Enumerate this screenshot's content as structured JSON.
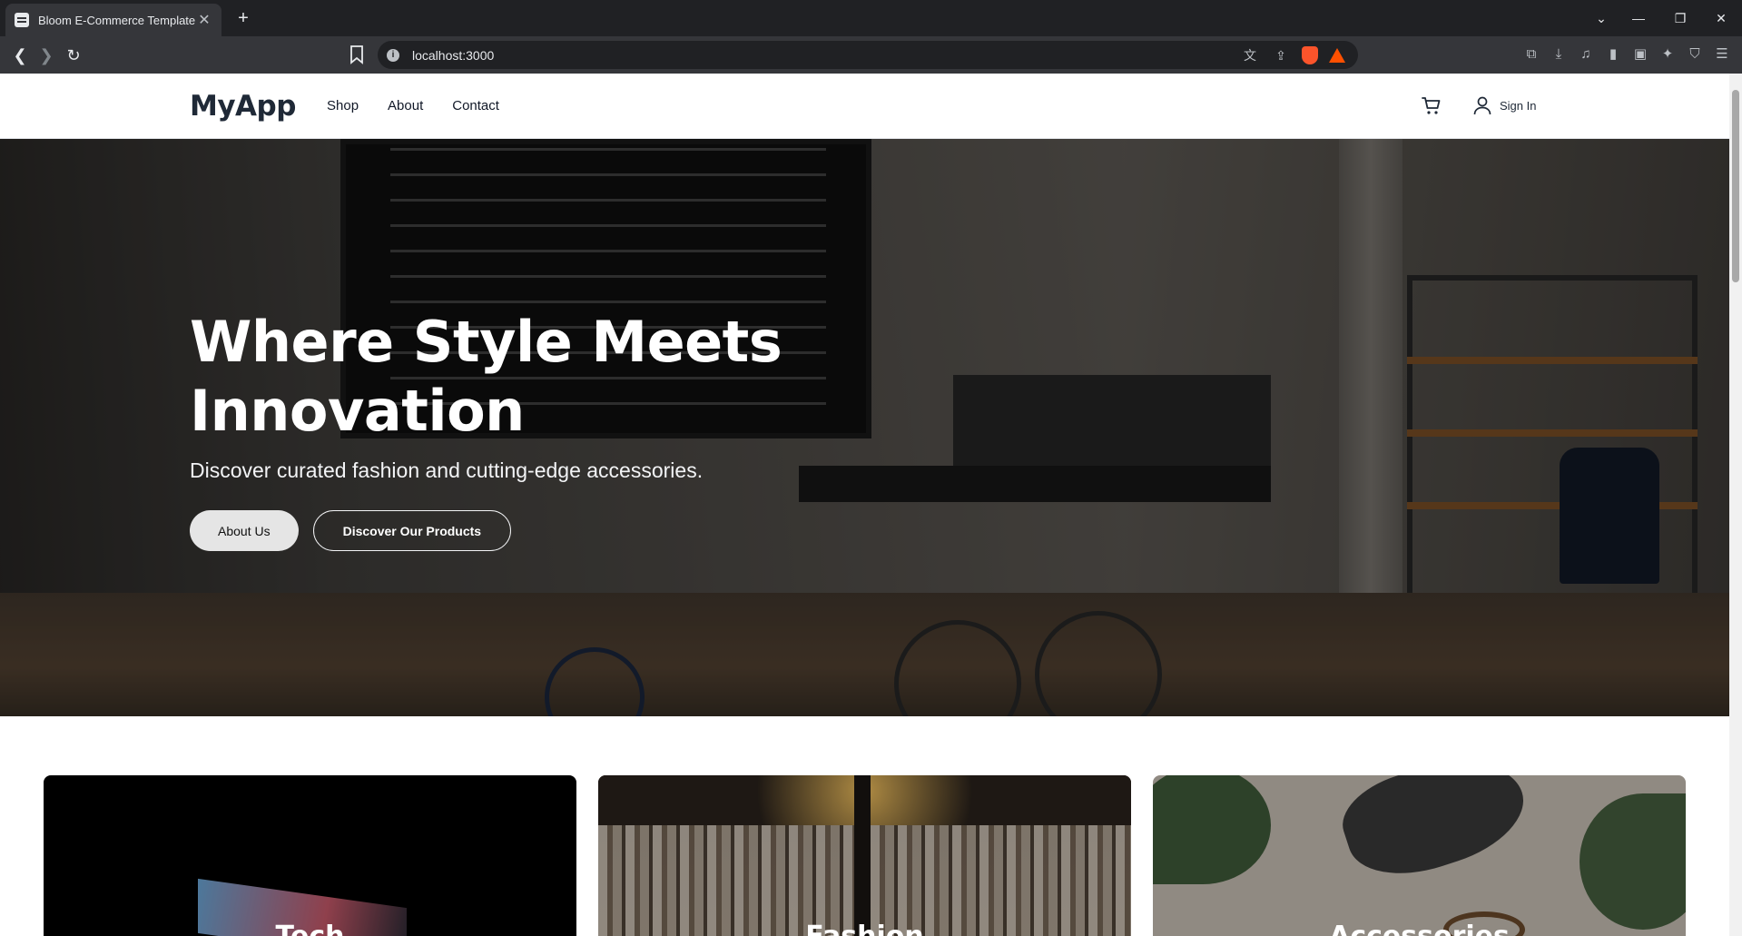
{
  "browser": {
    "tab_title": "Bloom E-Commerce Template",
    "tab_close": "✕",
    "new_tab": "+",
    "url": "localhost:3000",
    "window": {
      "dropdown": "⌄",
      "minimize": "—",
      "restore": "❐",
      "close": "✕"
    }
  },
  "header": {
    "logo": "MyApp",
    "nav": [
      "Shop",
      "About",
      "Contact"
    ],
    "signin": "Sign In"
  },
  "hero": {
    "title_line1": "Where Style Meets",
    "title_line2": "Innovation",
    "subtitle": "Discover curated fashion and cutting-edge accessories.",
    "primary_button": "About Us",
    "secondary_button": "Discover Our Products"
  },
  "categories": [
    {
      "label": "Tech"
    },
    {
      "label": "Fashion"
    },
    {
      "label": "Accessories"
    }
  ],
  "icons": {
    "cart": "cart-icon",
    "user": "user-icon",
    "back": "back-arrow-icon",
    "forward": "forward-arrow-icon",
    "reload": "reload-icon"
  }
}
